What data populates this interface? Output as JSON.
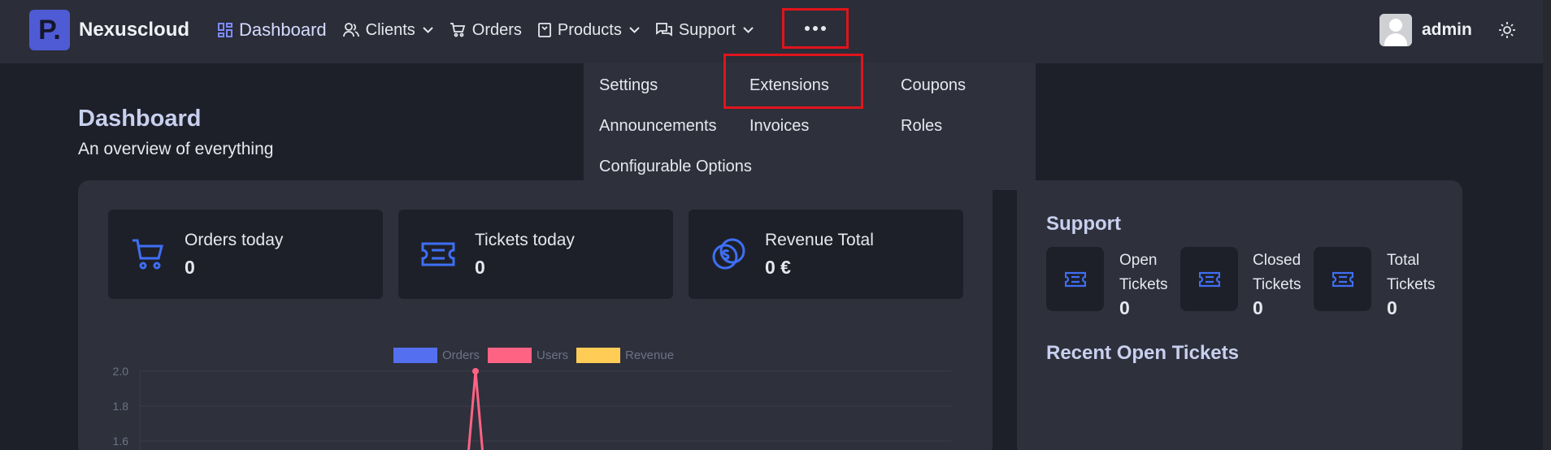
{
  "brand": {
    "logo_letter": "P.",
    "name": "Nexuscloud"
  },
  "nav": {
    "dashboard": "Dashboard",
    "clients": "Clients",
    "orders": "Orders",
    "products": "Products",
    "support": "Support",
    "more_icon": "ellipsis-icon"
  },
  "user": {
    "name": "admin"
  },
  "page": {
    "title": "Dashboard",
    "subtitle": "An overview of everything"
  },
  "stats": [
    {
      "label": "Orders today",
      "value": "0",
      "icon": "cart-icon"
    },
    {
      "label": "Tickets today",
      "value": "0",
      "icon": "ticket-icon"
    },
    {
      "label": "Revenue Total",
      "value": "0 €",
      "icon": "coins-icon"
    }
  ],
  "dropdown": {
    "items": [
      "Settings",
      "Extensions",
      "Coupons",
      "Announcements",
      "Invoices",
      "Roles",
      "Configurable Options"
    ]
  },
  "support": {
    "title": "Support",
    "open_label_1": "Open",
    "open_label_2": "Tickets",
    "open_value": "0",
    "closed_label_1": "Closed",
    "closed_label_2": "Tickets",
    "closed_value": "0",
    "total_label_1": "Total",
    "total_label_2": "Tickets",
    "total_value": "0",
    "recent_title": "Recent Open Tickets"
  },
  "colors": {
    "accent": "#4f5bd5",
    "icon_blue": "#3e6ff5",
    "orders": "#5470f0",
    "users": "#ff6384",
    "revenue": "#ffcd56"
  },
  "chart_data": {
    "type": "line",
    "series": [
      {
        "name": "Orders",
        "values": []
      },
      {
        "name": "Users",
        "values": [
          0,
          2,
          0
        ]
      },
      {
        "name": "Revenue",
        "values": []
      }
    ],
    "yticks": [
      "2.0",
      "1.8",
      "1.6"
    ],
    "ylim": [
      1.6,
      2.0
    ],
    "grid": true,
    "legend": "top"
  }
}
